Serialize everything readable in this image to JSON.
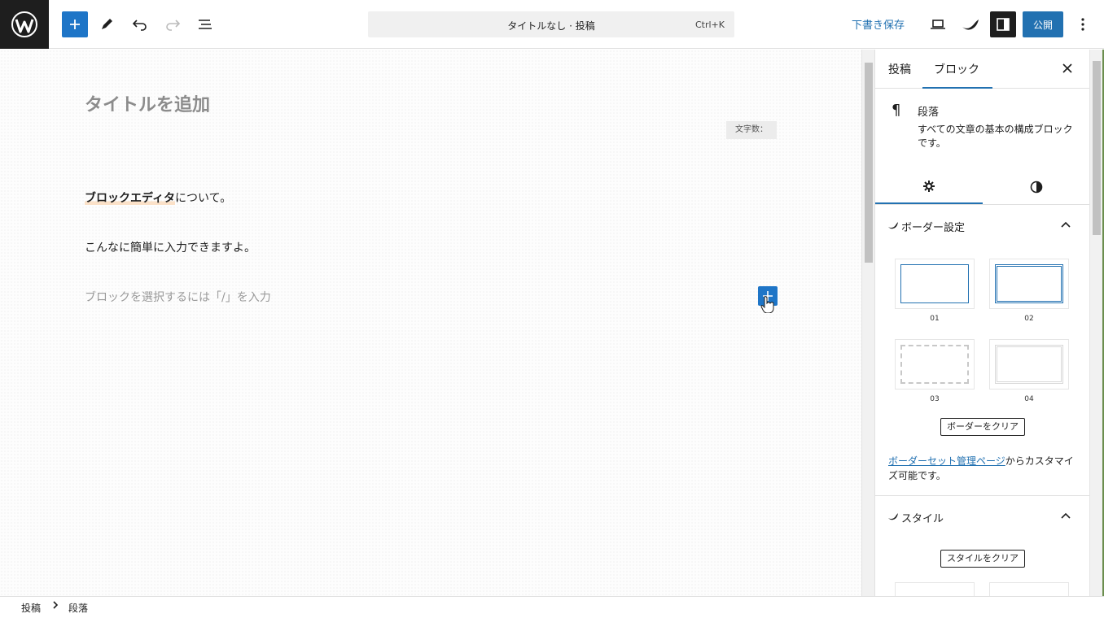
{
  "toolbar": {
    "command_title": "タイトルなし · 投稿",
    "command_shortcut": "Ctrl+K",
    "save_draft": "下書き保存",
    "publish": "公開"
  },
  "editor": {
    "title_placeholder": "タイトルを追加",
    "char_count_label": "文字数：",
    "para1_bold": "ブロックエディタ",
    "para1_rest": "について。",
    "para2": "こんなに簡単に入力できますよ。",
    "block_placeholder": "ブロックを選択するには「/」を入力"
  },
  "sidebar": {
    "tabs": [
      {
        "label": "投稿",
        "active": false
      },
      {
        "label": "ブロック",
        "active": true
      }
    ],
    "block_name": "段落",
    "block_description": "すべての文章の基本の構成ブロックです。",
    "border_panel": {
      "title": "ボーダー設定",
      "options": [
        "01",
        "02",
        "03",
        "04"
      ],
      "clear_button": "ボーダーをクリア",
      "link_text": "ボーダーセット管理ページ",
      "note_rest": "からカスタマイズ可能です。"
    },
    "style_panel": {
      "title": "スタイル",
      "clear_button": "スタイルをクリア"
    }
  },
  "breadcrumb": [
    "投稿",
    "段落"
  ],
  "colors": {
    "accent": "#2271b1",
    "inserter": "#1e75c7",
    "dark": "#1e1e1e"
  }
}
